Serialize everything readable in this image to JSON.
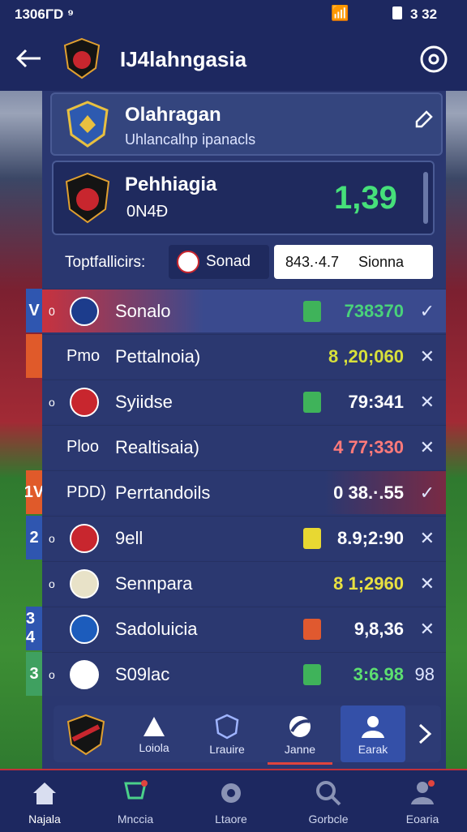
{
  "status_bar": {
    "time": "1306ΓD ⁹",
    "battery": "3 32"
  },
  "header": {
    "title": "IJ4lahngasia"
  },
  "league_card": {
    "title": "Olahragan",
    "subtitle": "Uhlancalhp ipanacls"
  },
  "match_card": {
    "team": "Pehhiagia",
    "sub": "0N4Ð",
    "score": "1,39"
  },
  "filters": {
    "label": "Toptfallicirs:",
    "chip_label": "Sonad",
    "search_value": "843.·4.7",
    "search_suffix": "Sionna"
  },
  "rows": [
    {
      "side": "V",
      "pre": "0",
      "name": "Sonalo",
      "score": "738370",
      "score_color": "#49d27a",
      "action": "✓",
      "tag_color": "#3fb35a"
    },
    {
      "side": "",
      "pre": "Pmo",
      "name": "Pettalnoia)",
      "score": "8 ,20;060",
      "score_color": "#d8e03a",
      "action": "✕",
      "tag_color": ""
    },
    {
      "side": "",
      "pre": "o",
      "name": "Syiidse",
      "score": "79:341",
      "score_color": "#ffffff",
      "action": "✕",
      "tag_color": "#3fb35a"
    },
    {
      "side": "",
      "pre": "Ploo",
      "name": "Realtisaia)",
      "score": "4 77;330",
      "score_color": "#ff7a7a",
      "action": "✕",
      "tag_color": ""
    },
    {
      "side": "1V",
      "pre": "PDD)",
      "name": "Perrtandoils",
      "score": "0 38.·.55",
      "score_color": "#ffffff",
      "action": "✓",
      "tag_color": ""
    },
    {
      "side": "2",
      "pre": "o",
      "name": "9ell",
      "score": "8.9;2:90",
      "score_color": "#ffffff",
      "action": "✕",
      "tag_color": "#e8d832"
    },
    {
      "side": "",
      "pre": "o",
      "name": "Sennpara",
      "score": "8 1;2960",
      "score_color": "#e8e040",
      "action": "✕",
      "tag_color": ""
    },
    {
      "side": "3 4",
      "pre": "",
      "name": "Sadoluicia",
      "score": "9,8,36",
      "score_color": "#ffffff",
      "action": "✕",
      "tag_color": "#e0592f"
    },
    {
      "side": "3",
      "pre": "o",
      "name": "S09lac",
      "score": "3:6.98",
      "score_color": "#5ddf70",
      "action": "98",
      "tag_color": "#3fb35a"
    }
  ],
  "tabs": [
    {
      "label": "Loiola",
      "icon": "warning-icon"
    },
    {
      "label": "Lrauire",
      "icon": "shield-icon"
    },
    {
      "label": "Janne",
      "icon": "ball-icon"
    },
    {
      "label": "Earak",
      "icon": "user-icon"
    }
  ],
  "nav": [
    {
      "label": "Najala",
      "icon": "home-icon"
    },
    {
      "label": "Mnccia",
      "icon": "trophy-icon"
    },
    {
      "label": "Ltaore",
      "icon": "gear-icon"
    },
    {
      "label": "Gorbcle",
      "icon": "search-icon"
    },
    {
      "label": "Eoaria",
      "icon": "profile-icon"
    }
  ],
  "colors": {
    "primary": "#1d2860",
    "panel": "#2a3770",
    "accent_red": "#c0313b",
    "accent_green": "#3fb35a"
  }
}
